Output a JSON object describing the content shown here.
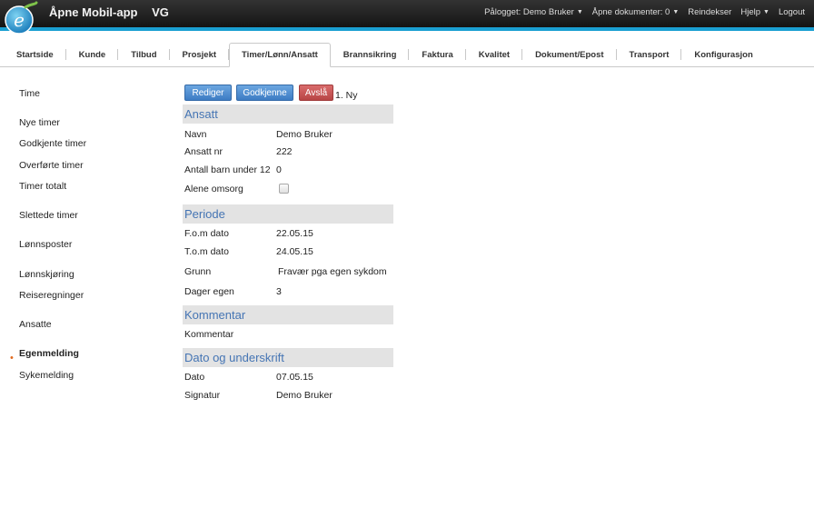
{
  "header": {
    "app_title": "Åpne Mobil-app",
    "company": "VG",
    "logged_in": "Pålogget: Demo Bruker",
    "open_documents": "Åpne dokumenter: 0",
    "reindex": "Reindekser",
    "help": "Hjelp",
    "logout": "Logout"
  },
  "tabs": [
    {
      "label": "Startside"
    },
    {
      "label": "Kunde"
    },
    {
      "label": "Tilbud"
    },
    {
      "label": "Prosjekt"
    },
    {
      "label": "Timer/Lønn/Ansatt",
      "active": true
    },
    {
      "label": "Brannsikring"
    },
    {
      "label": "Faktura"
    },
    {
      "label": "Kvalitet"
    },
    {
      "label": "Dokument/Epost"
    },
    {
      "label": "Transport"
    },
    {
      "label": "Konfigurasjon"
    }
  ],
  "sidebar": {
    "items": [
      {
        "label": "Time"
      },
      {
        "label": "Nye timer"
      },
      {
        "label": "Godkjente timer"
      },
      {
        "label": "Overførte timer"
      },
      {
        "label": "Timer totalt"
      },
      {
        "label": "Slettede timer"
      },
      {
        "label": "Lønnsposter"
      },
      {
        "label": "Lønnskjøring"
      },
      {
        "label": "Reiseregninger"
      },
      {
        "label": "Ansatte"
      },
      {
        "label": "Egenmelding",
        "active": true
      },
      {
        "label": "Sykemelding"
      }
    ]
  },
  "actions": {
    "edit": "Rediger",
    "approve": "Godkjenne",
    "reject": "Avslå",
    "status": "1. Ny"
  },
  "sections": {
    "employee": {
      "title": "Ansatt",
      "name_label": "Navn",
      "name_value": "Demo Bruker",
      "number_label": "Ansatt nr",
      "number_value": "222",
      "children_label": "Antall barn under 12",
      "children_value": "0",
      "sole_care_label": "Alene omsorg",
      "sole_care_checked": false
    },
    "period": {
      "title": "Periode",
      "from_label": "F.o.m dato",
      "from_value": "22.05.15",
      "to_label": "T.o.m dato",
      "to_value": "24.05.15",
      "reason_label": "Grunn",
      "reason_value": "Fravær pga egen sykdom",
      "days_label": "Dager egen",
      "days_value": "3"
    },
    "comment": {
      "title": "Kommentar",
      "comment_label": "Kommentar"
    },
    "signature": {
      "title": "Dato og underskrift",
      "date_label": "Dato",
      "date_value": "07.05.15",
      "signature_label": "Signatur",
      "signature_value": "Demo Bruker"
    }
  },
  "colors": {
    "accent": "#1a9fd1",
    "section_title": "#4575b4",
    "active_bullet": "#e26a1e"
  }
}
